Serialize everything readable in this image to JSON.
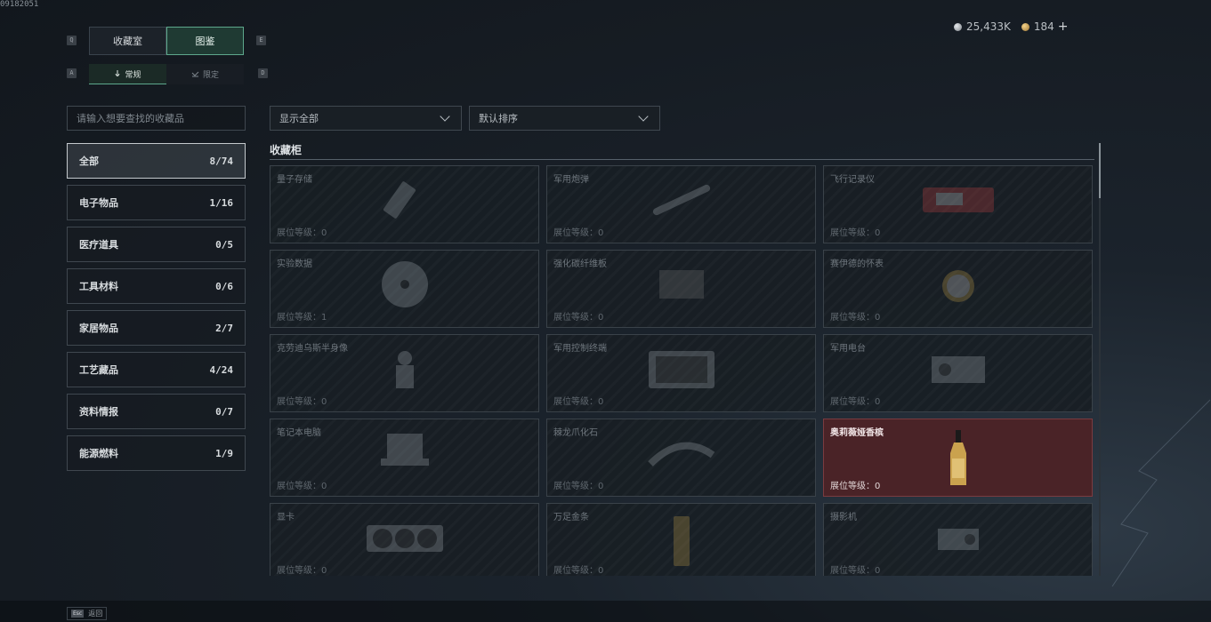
{
  "build_id": "09182051",
  "currency": {
    "silver": "25,433K",
    "gold": "184",
    "add_label": "+"
  },
  "tabs": {
    "prev_key": "Q",
    "next_key": "E",
    "items": [
      {
        "label": "收藏室",
        "active": false
      },
      {
        "label": "图鉴",
        "active": true
      }
    ]
  },
  "subtabs": {
    "prev_key": "A",
    "next_key": "D",
    "items": [
      {
        "label": "常规",
        "active": true
      },
      {
        "label": "限定",
        "active": false
      }
    ]
  },
  "search": {
    "placeholder": "请输入想要查找的收藏品"
  },
  "filters": {
    "show": "显示全部",
    "sort": "默认排序"
  },
  "categories": [
    {
      "label": "全部",
      "count": "8/74",
      "active": true
    },
    {
      "label": "电子物品",
      "count": "1/16"
    },
    {
      "label": "医疗道具",
      "count": "0/5"
    },
    {
      "label": "工具材料",
      "count": "0/6"
    },
    {
      "label": "家居物品",
      "count": "2/7"
    },
    {
      "label": "工艺藏品",
      "count": "4/24"
    },
    {
      "label": "资料情报",
      "count": "0/7"
    },
    {
      "label": "能源燃料",
      "count": "1/9"
    }
  ],
  "section_title": "收藏柜",
  "level_label": "展位等级：",
  "items": [
    {
      "name": "量子存储",
      "level": "0",
      "icon": "usb-drive-icon"
    },
    {
      "name": "军用炮弹",
      "level": "0",
      "icon": "artillery-shell-icon"
    },
    {
      "name": "飞行记录仪",
      "level": "0",
      "icon": "flight-recorder-icon"
    },
    {
      "name": "实验数据",
      "level": "1",
      "icon": "data-disc-icon"
    },
    {
      "name": "强化碳纤维板",
      "level": "0",
      "icon": "carbon-plate-icon"
    },
    {
      "name": "赛伊德的怀表",
      "level": "0",
      "icon": "pocket-watch-icon"
    },
    {
      "name": "克劳迪乌斯半身像",
      "level": "0",
      "icon": "bust-statue-icon"
    },
    {
      "name": "军用控制终端",
      "level": "0",
      "icon": "control-terminal-icon"
    },
    {
      "name": "军用电台",
      "level": "0",
      "icon": "military-radio-icon"
    },
    {
      "name": "笔记本电脑",
      "level": "0",
      "icon": "laptop-icon"
    },
    {
      "name": "棘龙爪化石",
      "level": "0",
      "icon": "claw-fossil-icon"
    },
    {
      "name": "奥莉薇娅香槟",
      "level": "0",
      "icon": "champagne-bottle-icon",
      "highlight": true
    },
    {
      "name": "显卡",
      "level": "0",
      "icon": "graphics-card-icon"
    },
    {
      "name": "万足金条",
      "level": "0",
      "icon": "gold-bar-icon"
    },
    {
      "name": "摄影机",
      "level": "0",
      "icon": "camera-icon"
    }
  ],
  "footer": {
    "esc_key": "Esc",
    "back_label": "返回"
  }
}
